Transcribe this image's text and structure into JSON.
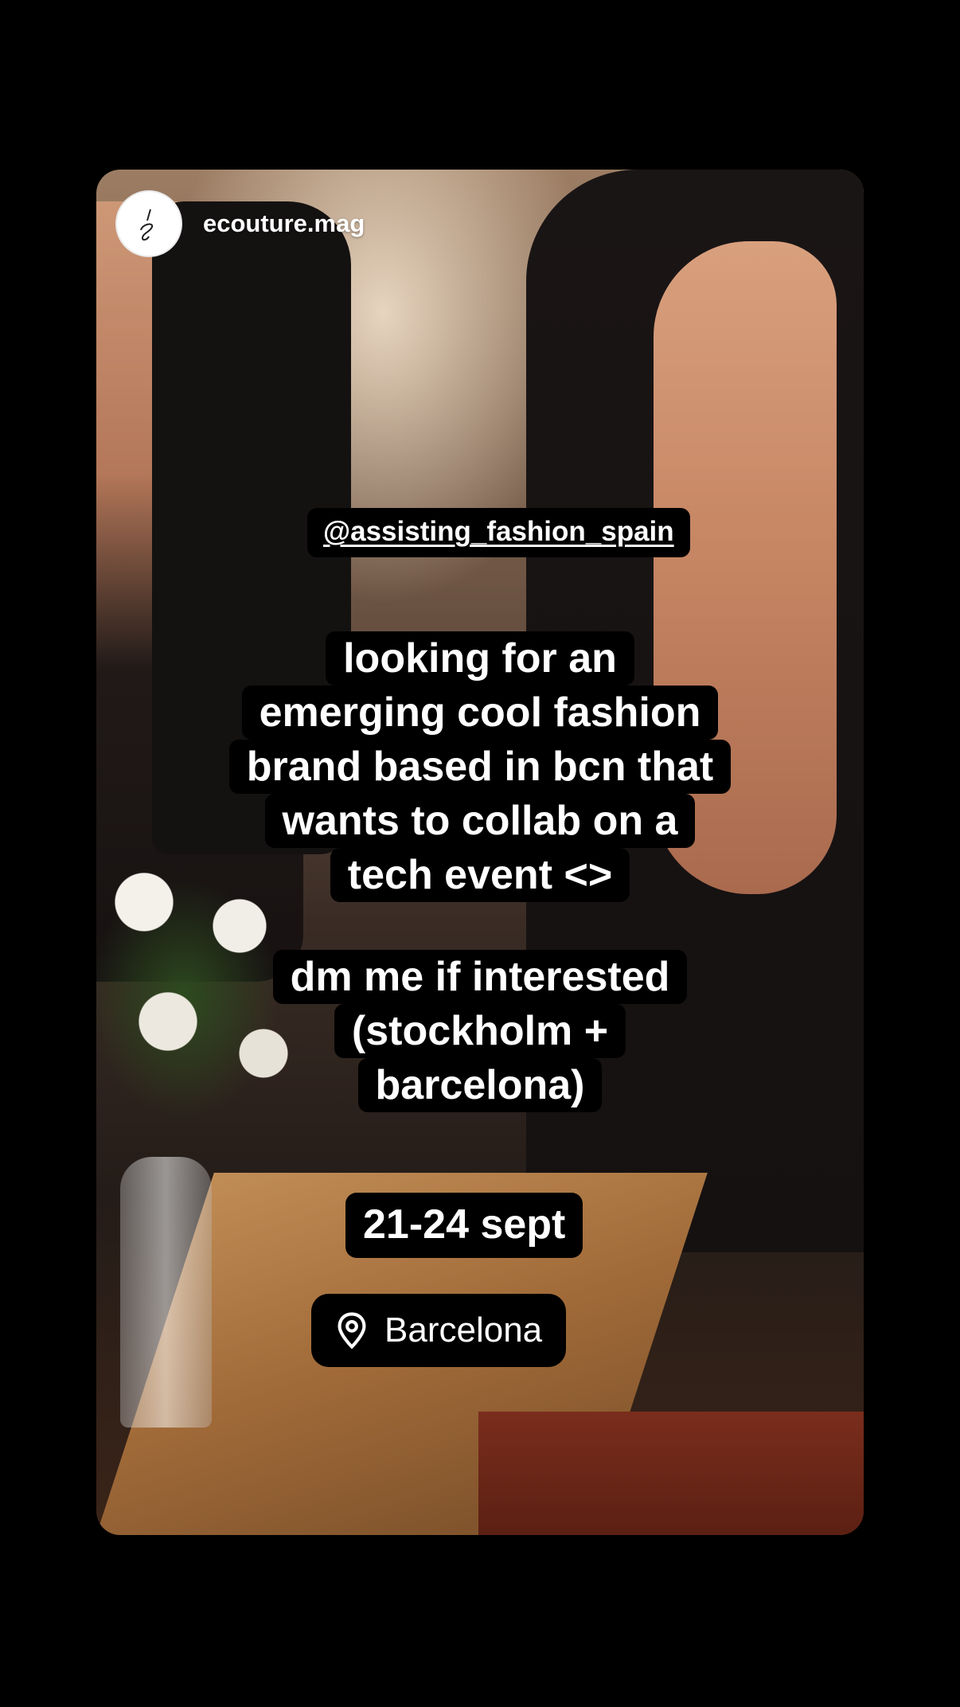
{
  "story": {
    "username": "ecouture.mag",
    "avatar_icon": "ecouture-logo",
    "mention": "@assisting_fashion_spain",
    "main_text": [
      "looking for an",
      "emerging cool fashion",
      "brand based in bcn that",
      "wants to collab on a",
      "tech event <>"
    ],
    "dm_text": [
      "dm me if interested",
      "(stockholm +",
      "barcelona)"
    ],
    "date": "21-24 sept",
    "location": "Barcelona",
    "location_icon": "location-pin-icon"
  },
  "colors": {
    "background": "#000000",
    "sticker_bg": "#000000",
    "sticker_text": "#ffffff"
  }
}
